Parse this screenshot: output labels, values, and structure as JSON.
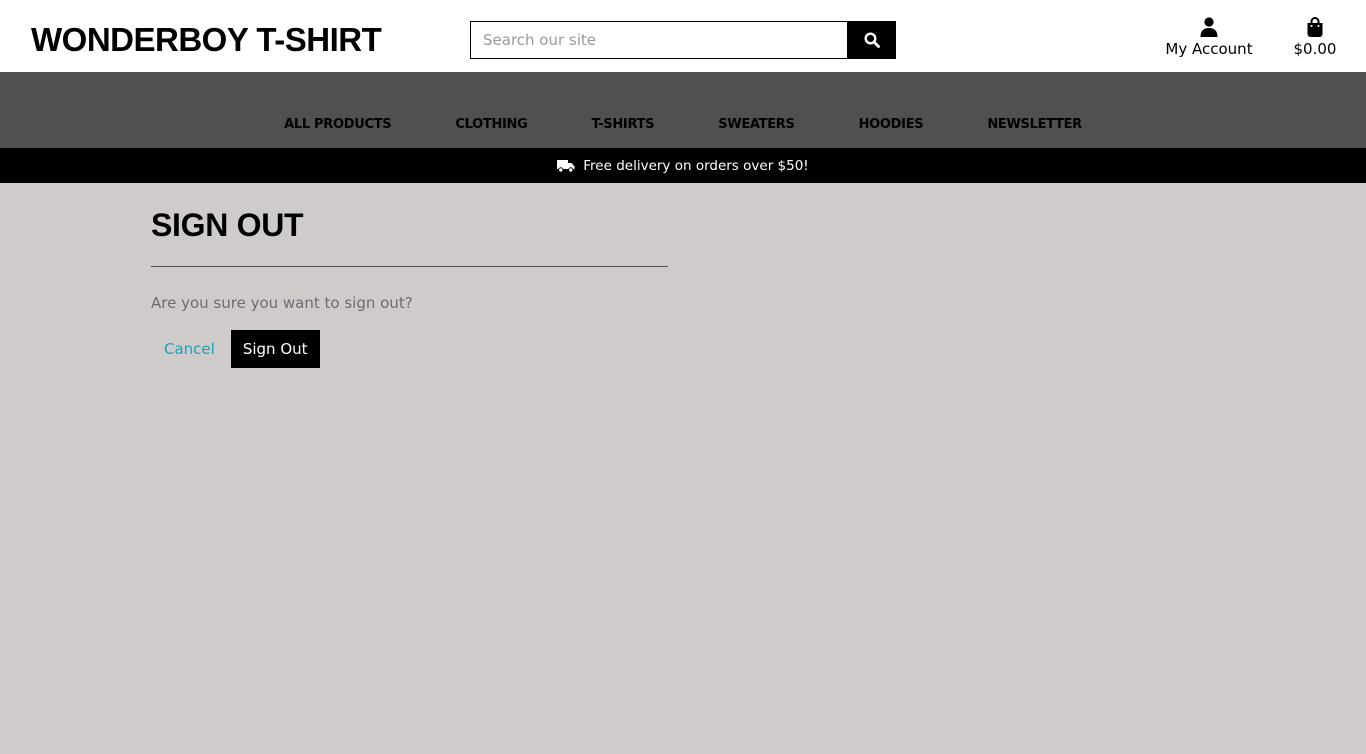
{
  "header": {
    "logo": "WONDERBOY T-SHIRT",
    "search": {
      "placeholder": "Search our site",
      "value": "",
      "button_icon": "search-icon"
    },
    "account": {
      "label": "My Account",
      "icon": "user-icon"
    },
    "bag": {
      "total": "$0.00",
      "icon": "shopping-bag-icon"
    }
  },
  "nav": {
    "items": [
      {
        "label": "ALL PRODUCTS"
      },
      {
        "label": "CLOTHING"
      },
      {
        "label": "T-SHIRTS"
      },
      {
        "label": "SWEATERS"
      },
      {
        "label": "HOODIES"
      },
      {
        "label": "NEWSLETTER"
      }
    ]
  },
  "banner": {
    "text": "Free delivery on orders over $50!",
    "icon": "truck-icon"
  },
  "main": {
    "title": "SIGN OUT",
    "message": "Are you sure you want to sign out?",
    "cancel_label": "Cancel",
    "signout_label": "Sign Out"
  },
  "colors": {
    "page_background": "#cfcbcb",
    "nav_background": "#4f5150",
    "banner_background": "#000000",
    "link": "#17a2b8",
    "primary_button": "#000000"
  }
}
